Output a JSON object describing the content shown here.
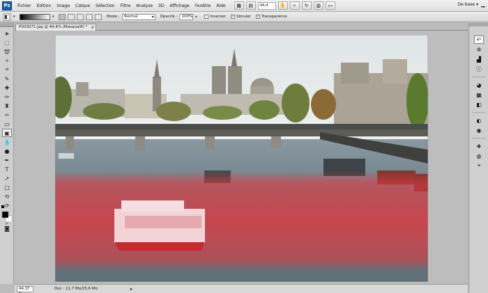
{
  "app": {
    "logo": "Ps"
  },
  "menu": [
    "Fichier",
    "Edition",
    "Image",
    "Calque",
    "Sélection",
    "Filtre",
    "Analyse",
    "3D",
    "Affichage",
    "Fenêtre",
    "Aide"
  ],
  "menubar": {
    "zoom_value": "44,4",
    "workspace": "De base"
  },
  "options": {
    "mode_label": "Mode :",
    "mode_value": "Normal",
    "opacity_label": "Opacité :",
    "opacity_value": "100%",
    "reverse_label": "Inverser",
    "dither_label": "Simuler",
    "transparency_label": "Transparence",
    "reverse_checked": false,
    "dither_checked": true,
    "transparency_checked": true
  },
  "document": {
    "tab_title": "P003071.jpg @ 44,4% (Masque/8) *"
  },
  "status": {
    "zoom": "44,37 %",
    "doc_info": "Doc : 11,7 Mo/15,6 Mo"
  },
  "colors": {
    "quick_mask_overlay": "#e8343c",
    "brand": "#1b5fa9",
    "foreground": "#000000",
    "background": "#ffffff"
  },
  "icons": {
    "toolbox": [
      "move-icon",
      "marquee-icon",
      "lasso-icon",
      "magic-wand-icon",
      "crop-icon",
      "eyedropper-icon",
      "healing-brush-icon",
      "brush-icon",
      "clone-stamp-icon",
      "history-brush-icon",
      "eraser-icon",
      "gradient-icon",
      "blur-icon",
      "dodge-icon",
      "pen-icon",
      "type-icon",
      "path-selection-icon",
      "shape-icon",
      "3d-rotate-icon",
      "3d-orbit-icon",
      "hand-icon",
      "zoom-icon"
    ],
    "dock": [
      "history-icon",
      "navigator-icon",
      "histogram-icon",
      "info-icon",
      "color-icon",
      "swatches-icon",
      "styles-icon",
      "adjustments-icon",
      "masks-icon",
      "layers-icon",
      "channels-icon",
      "paths-icon"
    ]
  }
}
